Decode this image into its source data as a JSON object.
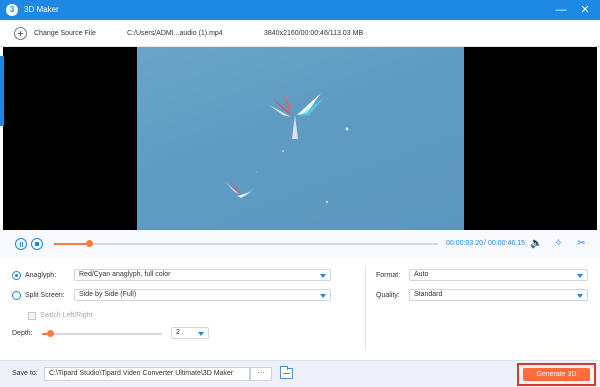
{
  "window": {
    "title": "3D Maker",
    "icon": "3d-maker-app-icon",
    "minimize_glyph": "—",
    "close_glyph": "✕"
  },
  "source": {
    "change_label": "Change Source File",
    "file_path": "C:/Users/ADMI...audio (1).mp4",
    "file_info": "3840x2160/00:00:46/113.03 MB"
  },
  "player": {
    "current_time": "00:00:03.20",
    "separator": "/",
    "total_time": "00:00:46.15",
    "progress_fraction": 0.09
  },
  "settings": {
    "anaglyph_label": "Anaglyph:",
    "anaglyph_value": "Red/Cyan anaglyph, full color",
    "split_label": "Split Screen:",
    "split_value": "Side by Side (Full)",
    "switch_label": "Switch Left/Right",
    "depth_label": "Depth:",
    "depth_value": "2",
    "depth_fraction": 0.07,
    "format_label": "Format:",
    "format_value": "Auto",
    "quality_label": "Quality:",
    "quality_value": "Standard",
    "selected_mode": "anaglyph"
  },
  "footer": {
    "save_label": "Save to:",
    "save_path": "C:\\Tipard Studio\\Tipard Video Converter Ultimate\\3D Maker",
    "more_label": "···",
    "generate_label": "Generate 3D"
  },
  "colors": {
    "accent": "#1e88e5",
    "generate": "#ff6b3d",
    "highlight_border": "#d93a2c"
  }
}
